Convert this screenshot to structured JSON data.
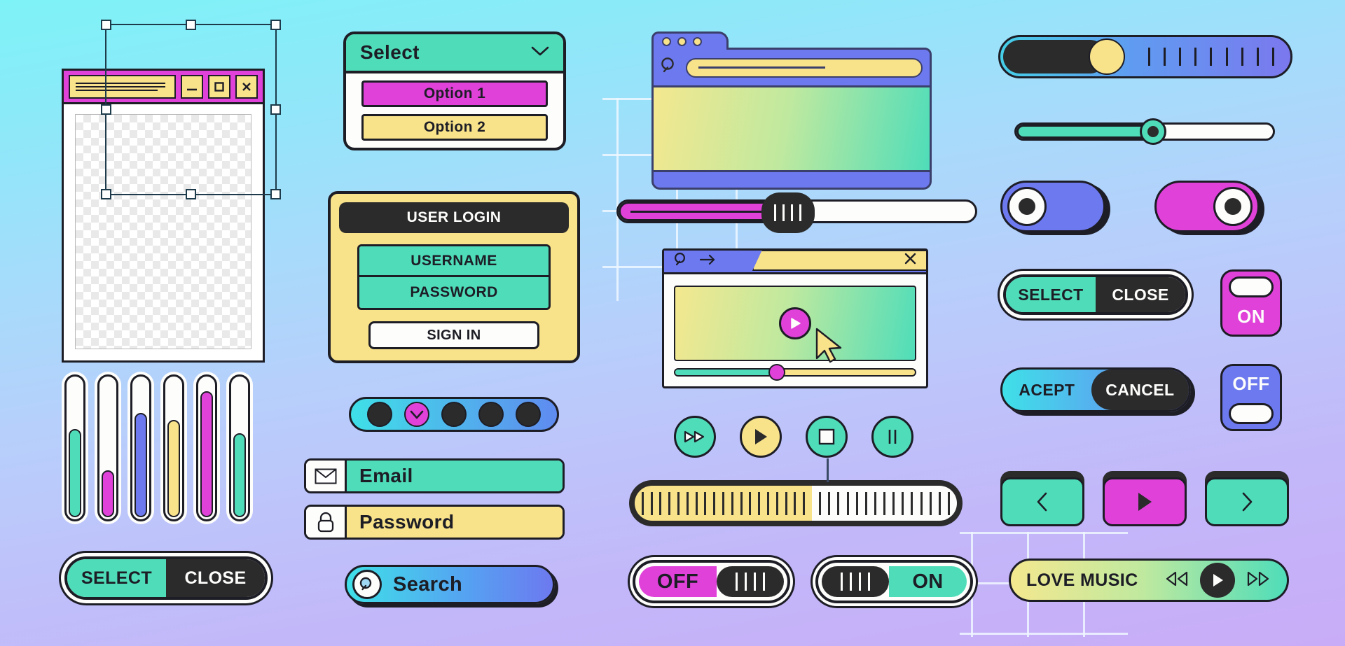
{
  "theme": {
    "ink": "#1d1d26",
    "teal": "#4fddb9",
    "magenta": "#e041d9",
    "yellow": "#f8e28a",
    "periwinkle": "#6d79ef",
    "cyan": "#3fe0e8",
    "white": "#fdfdfb",
    "dark": "#2b2b2b",
    "bg_top": "#7ef3f7",
    "bg_bottom": "#c9acf7"
  },
  "image_window": {
    "name": "image-editor-window",
    "title_lines": 3,
    "buttons": [
      {
        "name": "minimize-button",
        "glyph": "minimize"
      },
      {
        "name": "maximize-button",
        "glyph": "maximize"
      },
      {
        "name": "close-button",
        "glyph": "close"
      }
    ]
  },
  "vertical_sliders": {
    "name": "equalizer-sliders",
    "items": [
      {
        "label": "slider-1",
        "fill_percent": 62,
        "color": "#4fddb9"
      },
      {
        "label": "slider-2",
        "fill_percent": 33,
        "color": "#e041d9"
      },
      {
        "label": "slider-3",
        "fill_percent": 73,
        "color": "#6d79ef"
      },
      {
        "label": "slider-4",
        "fill_percent": 68,
        "color": "#f8e28a"
      },
      {
        "label": "slider-5",
        "fill_percent": 88,
        "color": "#e041d9"
      },
      {
        "label": "slider-6",
        "fill_percent": 59,
        "color": "#4fddb9"
      }
    ]
  },
  "select_close_bottom": {
    "left_label": "SELECT",
    "right_label": "CLOSE"
  },
  "dropdown": {
    "title": "Select",
    "chevron": "chevron-down-icon",
    "options": [
      {
        "label": "Option 1",
        "color": "#e041d9",
        "selected": true
      },
      {
        "label": "Option 2",
        "color": "#f8e28a",
        "selected": false
      }
    ]
  },
  "login_form": {
    "header": "USER LOGIN",
    "username_label": "USERNAME",
    "password_label": "PASSWORD",
    "submit_label": "SIGN IN"
  },
  "pager": {
    "name": "dot-pagination",
    "dots": [
      {
        "active": false
      },
      {
        "active": true
      },
      {
        "active": false
      },
      {
        "active": false
      },
      {
        "active": false
      }
    ],
    "check_glyph": "check-icon"
  },
  "fields": {
    "email": {
      "icon": "envelope-icon",
      "value": "Email",
      "color": "#4fddb9"
    },
    "password": {
      "icon": "lock-icon",
      "value": "Password",
      "color": "#f8e28a"
    }
  },
  "search_pill": {
    "icon": "search-icon",
    "value": "Search"
  },
  "folder_window": {
    "name": "folder-browser-window",
    "leds": 3,
    "search_icon": "search-icon",
    "url_value": ""
  },
  "grip_slider": {
    "name": "magenta-range-slider",
    "value_percent": 46
  },
  "video_window": {
    "name": "video-player-window",
    "search_icon": "search-icon",
    "forward_icon": "arrow-right-icon",
    "close_icon": "close-icon",
    "play_icon": "play-icon",
    "cursor_icon": "cursor-arrow-icon",
    "progress_percent": 43
  },
  "media_buttons": [
    {
      "name": "fast-forward-button",
      "icon": "fast-forward-icon",
      "color": "#4fddb9"
    },
    {
      "name": "play-button",
      "icon": "play-icon",
      "color": "#f8e28a"
    },
    {
      "name": "stop-button",
      "icon": "stop-icon",
      "color": "#4fddb9"
    },
    {
      "name": "pause-button",
      "icon": "pause-icon",
      "color": "#4fddb9"
    }
  ],
  "striped_progress": {
    "name": "striped-volume-bar",
    "value_percent": 55,
    "left_ticks": 19,
    "right_ticks": 15
  },
  "grip_toggles": [
    {
      "name": "off-toggle",
      "label": "OFF",
      "color": "#e041d9",
      "state": "off"
    },
    {
      "name": "on-toggle",
      "label": "ON",
      "color": "#4fddb9",
      "state": "on"
    }
  ],
  "big_slider": {
    "name": "gradient-knob-slider",
    "value_percent": 36,
    "ticks": 9
  },
  "thin_slider": {
    "name": "teal-thin-slider",
    "value_percent": 53
  },
  "radio_toggles": [
    {
      "name": "toggle-left-off",
      "color": "#6d79ef",
      "position": "left"
    },
    {
      "name": "toggle-right-on",
      "color": "#e041d9",
      "position": "right"
    }
  ],
  "select_close_right": {
    "left_label": "SELECT",
    "right_label": "CLOSE"
  },
  "accept_cancel": {
    "left_label": "ACEPT",
    "right_label": "CANCEL"
  },
  "vertical_toggles": [
    {
      "name": "on-switch",
      "label": "ON",
      "color": "#e041d9",
      "knob": "top"
    },
    {
      "name": "off-switch",
      "label": "OFF",
      "color": "#6d79ef",
      "knob": "bottom"
    }
  ],
  "nav_buttons": [
    {
      "name": "previous-button",
      "icon": "chevron-left-icon",
      "color": "#4fddb9"
    },
    {
      "name": "play-button",
      "icon": "play-icon",
      "color": "#e041d9"
    },
    {
      "name": "next-button",
      "icon": "chevron-right-icon",
      "color": "#4fddb9"
    }
  ],
  "music_bar": {
    "title": "LOVE MUSIC",
    "prev_icon": "rewind-icon",
    "play_icon": "play-icon",
    "next_icon": "fast-forward-icon"
  }
}
